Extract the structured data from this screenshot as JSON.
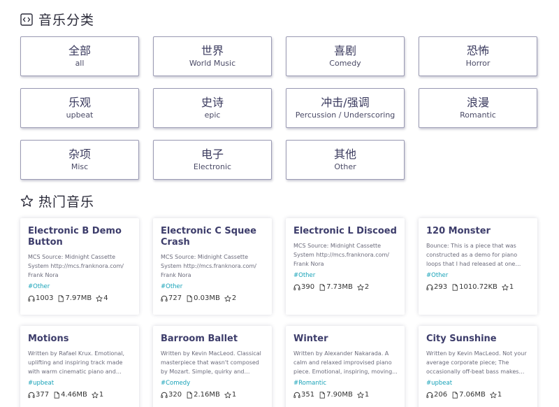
{
  "categories_section": {
    "title": "音乐分类",
    "icon": "code-brackets-icon"
  },
  "categories": [
    {
      "zh": "全部",
      "en": "all"
    },
    {
      "zh": "世界",
      "en": "World Music"
    },
    {
      "zh": "喜剧",
      "en": "Comedy"
    },
    {
      "zh": "恐怖",
      "en": "Horror"
    },
    {
      "zh": "乐观",
      "en": "upbeat"
    },
    {
      "zh": "史诗",
      "en": "epic"
    },
    {
      "zh": "冲击/强调",
      "en": "Percussion / Underscoring"
    },
    {
      "zh": "浪漫",
      "en": "Romantic"
    },
    {
      "zh": "杂项",
      "en": "Misc"
    },
    {
      "zh": "电子",
      "en": "Electronic"
    },
    {
      "zh": "其他",
      "en": "Other"
    }
  ],
  "hot_section": {
    "title": "热门音乐",
    "icon": "star-outline-icon"
  },
  "music": [
    {
      "title": "Electronic B Demo Button",
      "desc": "MCS Source: Midnight Cassette System http://mcs.franknora.com/   Frank Nora",
      "tag": "#Other",
      "plays": "1003",
      "size": "7.97MB",
      "stars": "4"
    },
    {
      "title": "Electronic C Squee Crash",
      "desc": "MCS Source: Midnight Cassette System http://mcs.franknora.com/   Frank Nora",
      "tag": "#Other",
      "plays": "727",
      "size": "0.03MB",
      "stars": "2"
    },
    {
      "title": "Electronic L Discoed",
      "desc": "MCS Source: Midnight Cassette System http://mcs.franknora.com/   Frank Nora",
      "tag": "#Other",
      "plays": "390",
      "size": "7.73MB",
      "stars": "2"
    },
    {
      "title": "120 Monster",
      "desc": "Bounce: This is a piece that was constructed as a demo for piano loops that I had released at one time. It is...",
      "tag": "#Other",
      "plays": "293",
      "size": "1010.72KB",
      "stars": "1"
    },
    {
      "title": "Motions",
      "desc": "Written by Rafael Krux. Emotional, uplifting and inspiring track made with warm cinematic piano and soft...",
      "tag": "#upbeat",
      "plays": "377",
      "size": "4.46MB",
      "stars": "1"
    },
    {
      "title": "Barroom Ballet",
      "desc": "Written by Kevin MacLeod. Classical masterpiece that wasn't composed by Mozart. Simple, quirky and classically...",
      "tag": "#Comedy",
      "plays": "320",
      "size": "2.16MB",
      "stars": "1"
    },
    {
      "title": "Winter",
      "desc": "Written by Alexander Nakarada. A calm and relaxed improvised piano piece. Emotional, inspiring, moving...",
      "tag": "#Romantic",
      "plays": "351",
      "size": "7.90MB",
      "stars": "1"
    },
    {
      "title": "City Sunshine",
      "desc": "Written by Kevin MacLeod. Not your average corporate piece; The occasionally off-beat bass makes this...",
      "tag": "#upbeat",
      "plays": "206",
      "size": "7.06MB",
      "stars": "1"
    }
  ],
  "colors": {
    "tag": "#17a2b8",
    "title": "#3d3d6b",
    "card_border": "#9a9ab3"
  }
}
